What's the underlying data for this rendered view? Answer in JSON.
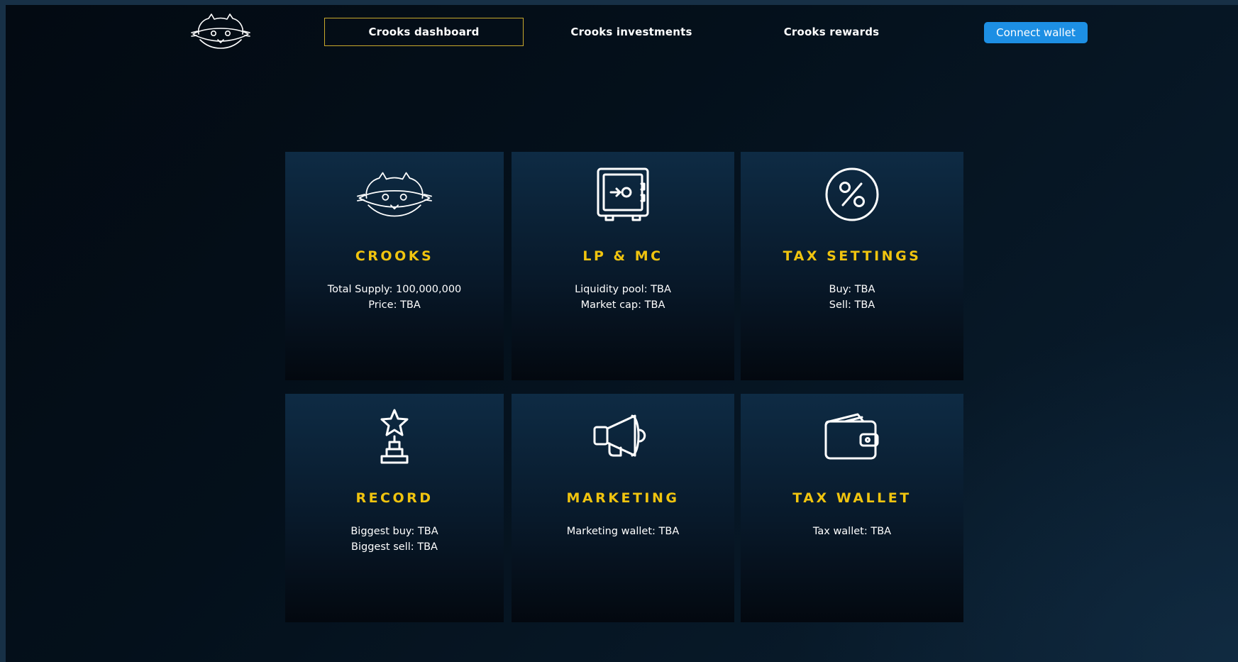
{
  "nav": {
    "items": [
      {
        "label": "Crooks dashboard",
        "active": true
      },
      {
        "label": "Crooks investments",
        "active": false
      },
      {
        "label": "Crooks rewards",
        "active": false
      }
    ],
    "connect_label": "Connect wallet"
  },
  "colors": {
    "accent_gold": "#f0c40f",
    "active_border": "#c8a92c",
    "button_blue": "#1d8fe4",
    "card_top": "#0e2b44",
    "background": "#04101b"
  },
  "cards": [
    {
      "icon": "raccoon-mask-icon",
      "title": "CROOKS",
      "lines": [
        "Total Supply: 100,000,000",
        "Price: TBA"
      ]
    },
    {
      "icon": "safe-icon",
      "title": "LP & MC",
      "lines": [
        "Liquidity pool: TBA",
        "Market cap: TBA"
      ]
    },
    {
      "icon": "percent-icon",
      "title": "TAX SETTINGS",
      "lines": [
        "Buy: TBA",
        "Sell: TBA"
      ]
    },
    {
      "icon": "trophy-icon",
      "title": "RECORD",
      "lines": [
        "Biggest buy: TBA",
        "Biggest sell: TBA"
      ]
    },
    {
      "icon": "megaphone-icon",
      "title": "MARKETING",
      "lines": [
        "Marketing wallet: TBA"
      ]
    },
    {
      "icon": "wallet-icon",
      "title": "TAX WALLET",
      "lines": [
        "Tax wallet: TBA"
      ]
    }
  ]
}
